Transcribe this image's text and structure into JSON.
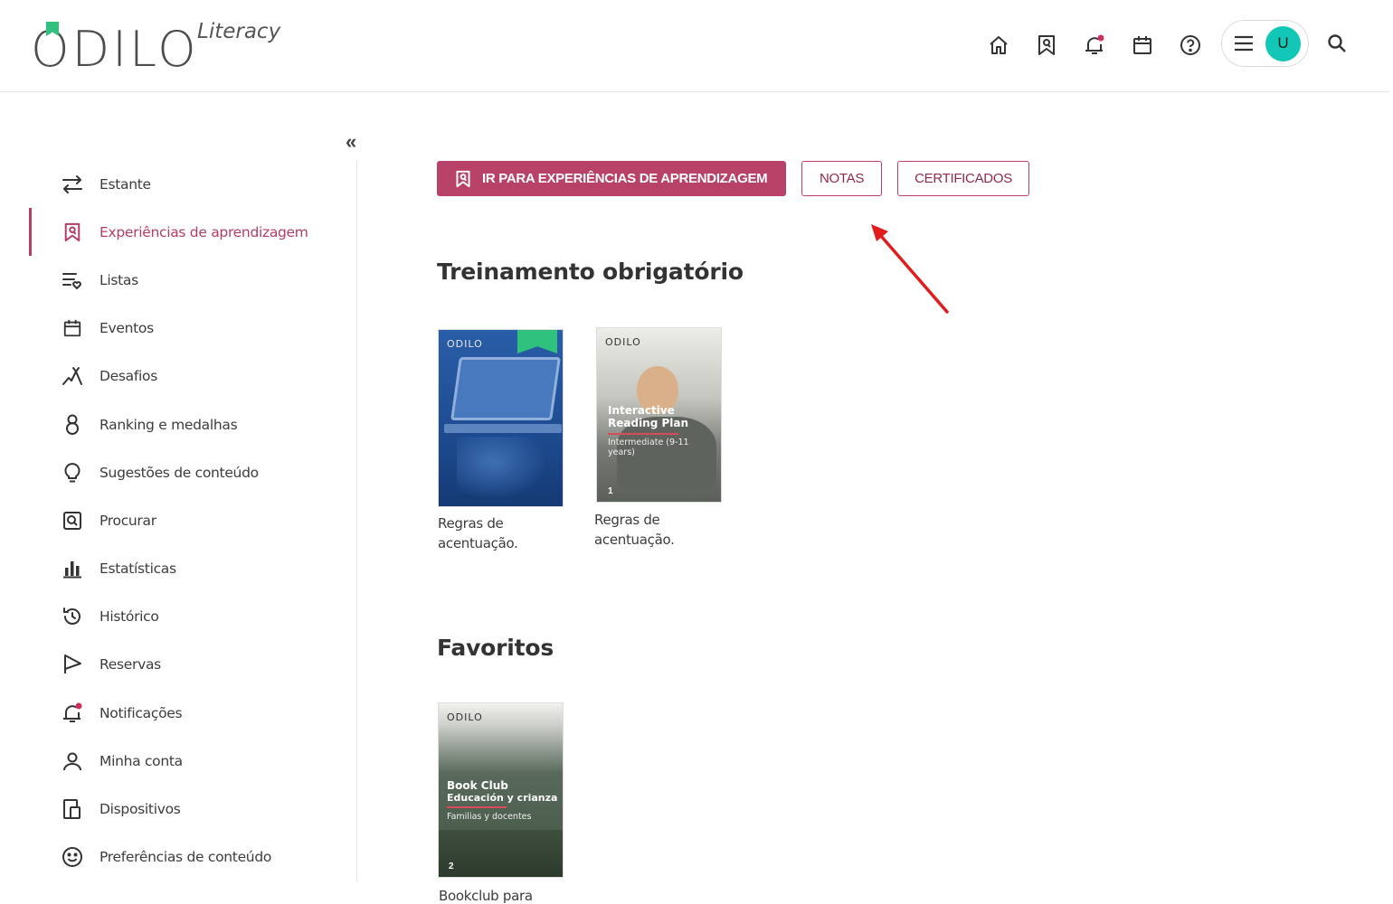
{
  "header": {
    "logo_text": "ODILO",
    "logo_sub": "Literacy",
    "nav": [
      {
        "icon": "home-icon"
      },
      {
        "icon": "learning-badge-icon"
      },
      {
        "icon": "bell-icon"
      },
      {
        "icon": "calendar-icon"
      },
      {
        "icon": "help-icon"
      }
    ],
    "avatar_initial": "U",
    "accent_color": "#b84267",
    "notification_dot_color": "#c8325a",
    "avatar_color": "#12c7b5"
  },
  "sidebar": {
    "collapse_label": "«",
    "items": [
      {
        "label": "Estante",
        "icon": "swap-arrows-icon"
      },
      {
        "label": "Experiências de aprendizagem",
        "icon": "learning-badge-icon",
        "active": true
      },
      {
        "label": "Listas",
        "icon": "list-heart-icon"
      },
      {
        "label": "Eventos",
        "icon": "calendar-icon"
      },
      {
        "label": "Desafios",
        "icon": "challenge-icon"
      },
      {
        "label": "Ranking e medalhas",
        "icon": "medal-icon"
      },
      {
        "label": "Sugestões de conteúdo",
        "icon": "lightbulb-icon"
      },
      {
        "label": "Procurar",
        "icon": "search-box-icon"
      },
      {
        "label": "Estatísticas",
        "icon": "bar-chart-icon"
      },
      {
        "label": "Histórico",
        "icon": "history-icon"
      },
      {
        "label": "Reservas",
        "icon": "flag-icon"
      },
      {
        "label": "Notificações",
        "icon": "bell-icon"
      },
      {
        "label": "Minha conta",
        "icon": "user-icon"
      },
      {
        "label": "Dispositivos",
        "icon": "devices-icon"
      },
      {
        "label": "Preferências de conteúdo",
        "icon": "smile-icon"
      }
    ]
  },
  "actions": {
    "primary": "IR PARA EXPERIÊNCIAS DE APRENDIZAGEM",
    "notes": "NOTAS",
    "certificates": "CERTIFICADOS"
  },
  "sections": {
    "mandatory": {
      "title": "Treinamento obrigatório",
      "cards": [
        {
          "title": "Regras de acentuação.",
          "cover_logo": "ODILO"
        },
        {
          "title": "Regras de acentuação.",
          "cover_logo": "ODILO",
          "cover_title": "Interactive Reading Plan",
          "cover_sub": "Intermediate (9-11 years)",
          "cover_num": "1"
        }
      ]
    },
    "favorites": {
      "title": "Favoritos",
      "cards": [
        {
          "title": "Bookclub para",
          "cover_logo": "ODILO",
          "cover_title_1": "Book Club",
          "cover_title_2": "Educación y crianza",
          "cover_sub": "Familias y docentes",
          "cover_num": "2"
        }
      ]
    }
  }
}
